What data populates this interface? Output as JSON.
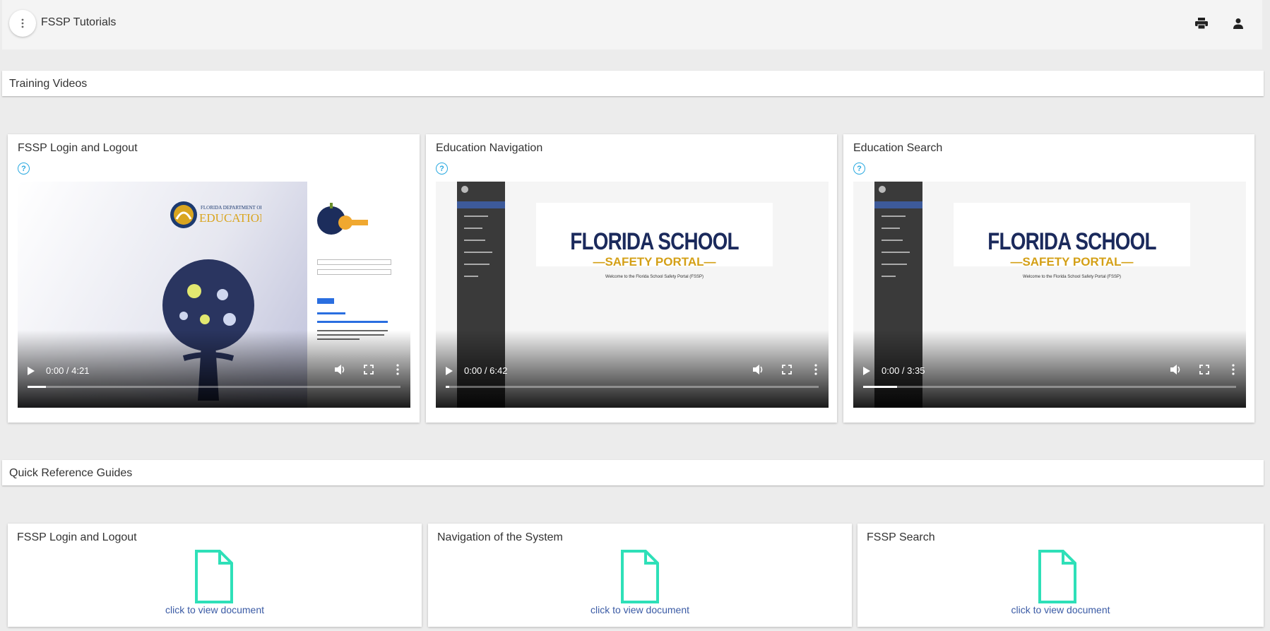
{
  "app": {
    "title": "FSSP Tutorials"
  },
  "icons": {
    "menu": "more-vert-icon",
    "print": "print-icon",
    "account": "person-icon"
  },
  "sections": {
    "videos": "Training Videos",
    "guides": "Quick Reference Guides"
  },
  "videos": [
    {
      "title": "FSSP Login and Logout",
      "time": "0:00 / 4:21",
      "progress": 0.05
    },
    {
      "title": "Education Navigation",
      "time": "0:00 / 6:42",
      "progress": 0.01
    },
    {
      "title": "Education Search",
      "time": "0:00 / 3:35",
      "progress": 0.09
    }
  ],
  "thumb": {
    "fdoe": "FLORIDA DEPARTMENT OF",
    "education": "EDUCATION",
    "florida": "FLORIDA",
    "school": "SCHOOL",
    "portal": "SAFETY PORTAL",
    "welcome": "Welcome to the Florida School Safety Portal (FSSP)"
  },
  "guides": [
    {
      "title": "FSSP Login and Logout",
      "link": "click to view document"
    },
    {
      "title": "Navigation of the System",
      "link": "click to view document"
    },
    {
      "title": "FSSP Search",
      "link": "click to view document"
    }
  ],
  "colors": {
    "help": "#29a9e0",
    "doc_icon": "#2ee0b8",
    "link": "#3b5ba5"
  }
}
